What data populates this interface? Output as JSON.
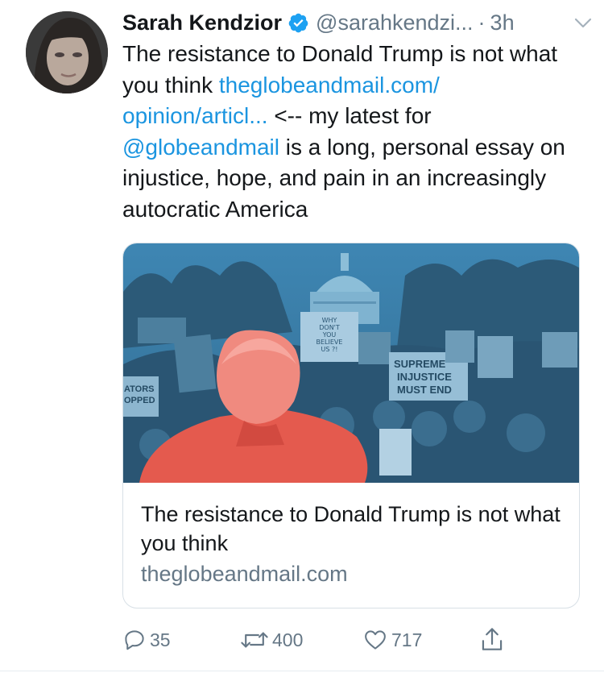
{
  "tweet": {
    "author_name": "Sarah Kendzior",
    "handle": "@sarahkendzi...",
    "separator": "·",
    "time": "3h",
    "text_part1": "The resistance to Donald Trump is not what you think  ",
    "link1": "theglobeandmail.com/ opinion/articl...",
    "text_part2": " <-- my latest for ",
    "mention": "@globeandmail",
    "text_part3": " is a long, personal essay on injustice, hope, and pain in an increasingly autocratic America"
  },
  "card": {
    "title": "The resistance to Donald Trump is not what you think",
    "domain": "theglobeandmail.com",
    "image_signs": {
      "sign1": "WHY DON'T YOU BELIEVE US ?!",
      "sign2": "SUPREME INJUSTICE MUST END",
      "sign3": "ATORS OPPED"
    }
  },
  "actions": {
    "replies": "35",
    "retweets": "400",
    "likes": "717"
  },
  "colors": {
    "link": "#1b95e0",
    "muted": "#657786",
    "image_blue": "#3f7fa3",
    "image_red": "#e85a4f"
  }
}
